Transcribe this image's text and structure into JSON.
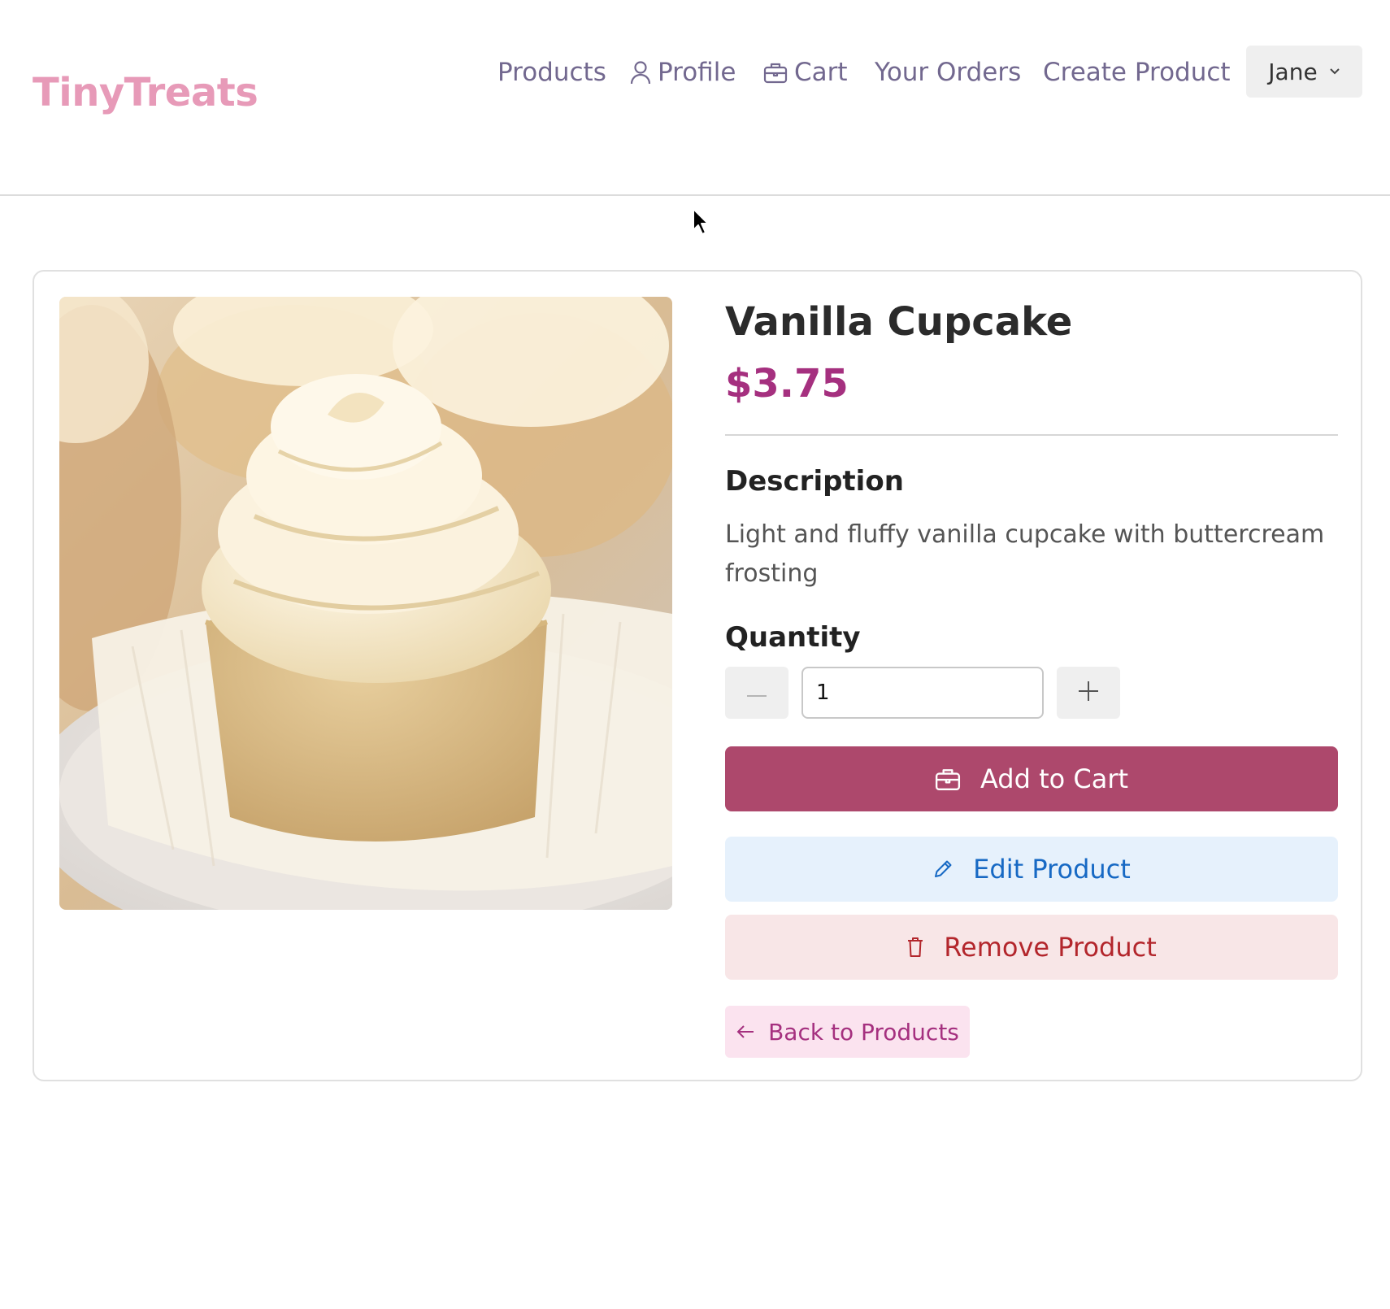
{
  "app": {
    "logo_text": "TinyTreats",
    "brand_color": "#e79ab8"
  },
  "nav": {
    "items": [
      {
        "label": "Products",
        "icon": null
      },
      {
        "label": "Profile",
        "icon": "user-icon"
      },
      {
        "label": "Cart",
        "icon": "cart-icon"
      },
      {
        "label": "Your Orders",
        "icon": null
      },
      {
        "label": "Create Product",
        "icon": null
      }
    ],
    "user_menu": {
      "label": "Jane",
      "icon": "chevron-down-icon"
    }
  },
  "product": {
    "title": "Vanilla Cupcake",
    "price": "$3.75",
    "price_color": "#a5307f",
    "image_alt": "Vanilla cupcake with buttercream swirl",
    "description_heading": "Description",
    "description": "Light and fluffy vanilla cupcake with buttercream frosting",
    "quantity_heading": "Quantity",
    "quantity_value": "1"
  },
  "actions": {
    "add_to_cart": {
      "label": "Add to Cart",
      "icon": "cart-icon",
      "color": "#ad486c"
    },
    "edit": {
      "label": "Edit Product",
      "icon": "pencil-icon",
      "color": "#1769c4"
    },
    "remove": {
      "label": "Remove Product",
      "icon": "trash-icon",
      "color": "#b3262c"
    },
    "back": {
      "label": "Back to Products",
      "icon": "arrow-left-icon"
    }
  }
}
